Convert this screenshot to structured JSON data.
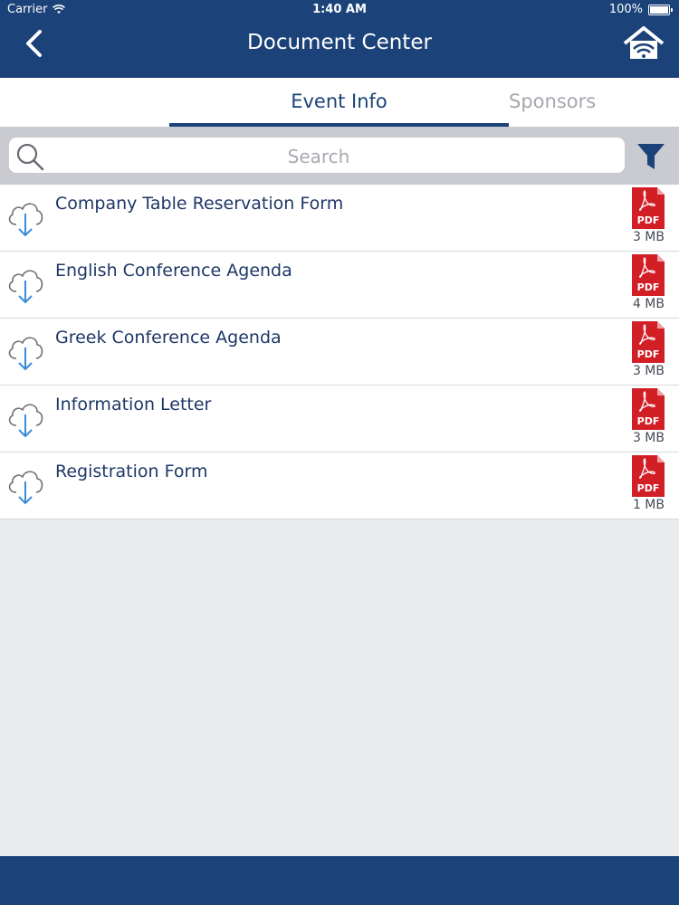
{
  "status_bar": {
    "carrier": "Carrier",
    "time": "1:40 AM",
    "battery": "100%",
    "battery_level": 1.0
  },
  "nav": {
    "title": "Document Center",
    "back_icon": "chevron-left-icon",
    "home_icon": "home-wifi-icon"
  },
  "tabs": [
    {
      "label": "Event Info",
      "active": true
    },
    {
      "label": "Sponsors",
      "active": false
    }
  ],
  "search": {
    "placeholder": "Search",
    "value": "",
    "filter_icon": "filter-icon"
  },
  "documents": [
    {
      "name": "Company Table Reservation Form",
      "type": "PDF",
      "size": "3 MB"
    },
    {
      "name": "English Conference Agenda",
      "type": "PDF",
      "size": "4 MB"
    },
    {
      "name": "Greek Conference Agenda",
      "type": "PDF",
      "size": "3 MB"
    },
    {
      "name": "Information Letter",
      "type": "PDF",
      "size": "3 MB"
    },
    {
      "name": "Registration Form",
      "type": "PDF",
      "size": "1 MB"
    }
  ],
  "colors": {
    "header": "#1b4379",
    "pdf_red": "#d21f26",
    "download_blue": "#3a8ad8",
    "text_dark": "#1e3767"
  }
}
